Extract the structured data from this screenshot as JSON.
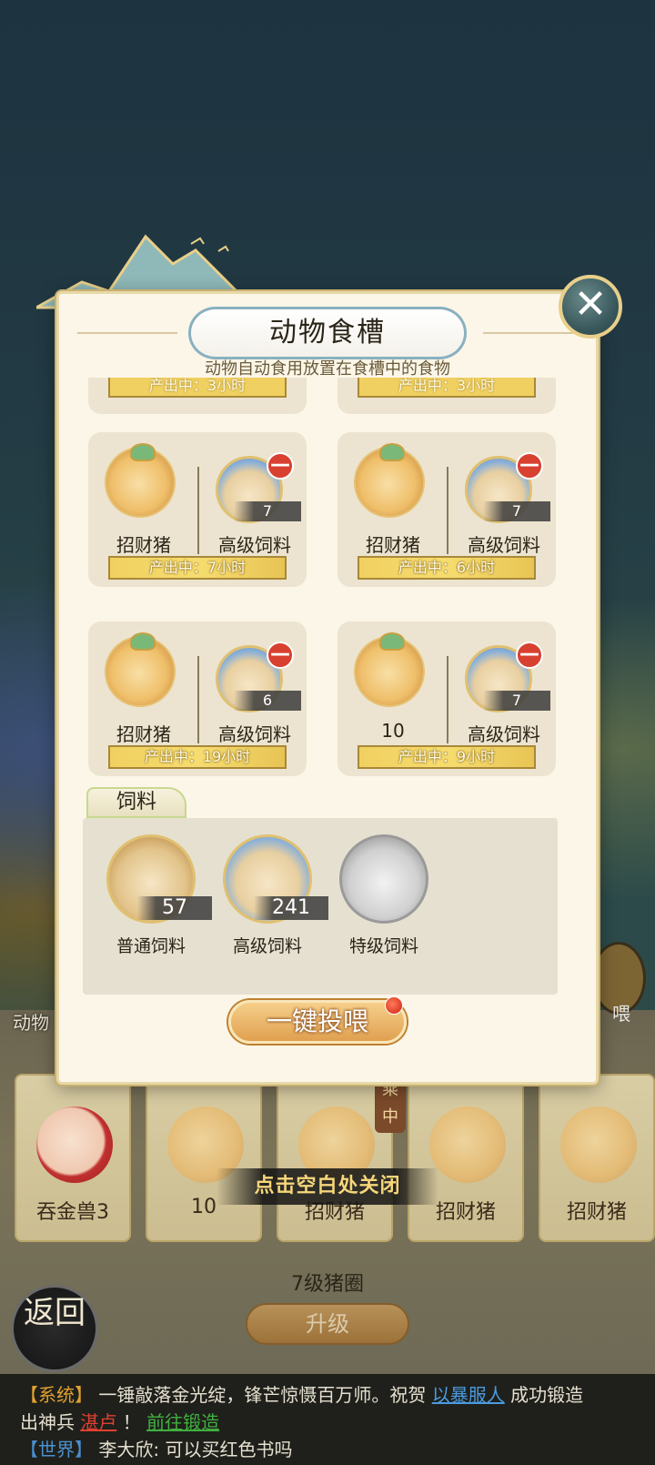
{
  "background": {
    "side_label": "动物",
    "right_badge": "喂",
    "pen_cards": [
      {
        "name": "吞金兽3"
      },
      {
        "name": "10"
      },
      {
        "name": "招财猪"
      },
      {
        "name": "招财猪"
      },
      {
        "name": "招财猪"
      }
    ],
    "riding_tag": "乘中",
    "close_tip": "点击空白处关闭",
    "pen_level": "7级猪圈",
    "upgrade_label": "升级",
    "back_label": "返回"
  },
  "modal": {
    "title": "动物食槽",
    "subtitle": "动物自动食用放置在食槽中的食物",
    "close_icon": "close-x",
    "partial_slots": [
      {
        "produce": "产出中：3小时"
      },
      {
        "produce": "产出中：3小时"
      }
    ],
    "slots": [
      {
        "animal": "招财猪",
        "feed": "高级饲料",
        "count": "7",
        "produce": "产出中：7小时"
      },
      {
        "animal": "招财猪",
        "feed": "高级饲料",
        "count": "7",
        "produce": "产出中：6小时"
      },
      {
        "animal": "招财猪",
        "feed": "高级饲料",
        "count": "6",
        "produce": "产出中：19小时"
      },
      {
        "animal": "10",
        "feed": "高级饲料",
        "count": "7",
        "produce": "产出中：9小时"
      }
    ],
    "remove_glyph": "—",
    "feed_tab": "饲料",
    "feeds": [
      {
        "name": "普通饲料",
        "qty": "57"
      },
      {
        "name": "高级饲料",
        "qty": "241"
      },
      {
        "name": "特级饲料",
        "qty": ""
      }
    ],
    "feed_all_label": "一键投喂"
  },
  "chat": {
    "line1_tag": "【系统】",
    "line1_text": "一锤敲落金光绽，锋芒惊慑百万师。祝贺",
    "line1_player": "以暴服人",
    "line1_text2": "成功锻造",
    "line2_text": "出神兵",
    "line2_item": "湛卢",
    "line2_punct": "！",
    "line2_link": "前往锻造",
    "line3_tag": "【世界】",
    "line3_text": "李大欣: 可以买红色书吗"
  },
  "colors": {
    "accent_gold": "#f0d060",
    "remove_red": "#d84030",
    "system_tag": "#e0a030",
    "world_tag": "#4a90d0"
  }
}
